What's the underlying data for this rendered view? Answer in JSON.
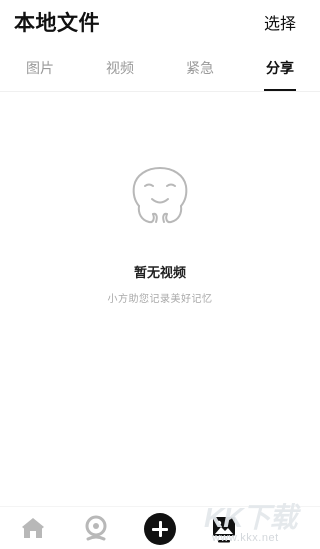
{
  "header": {
    "title": "本地文件",
    "select_label": "选择"
  },
  "tabs": [
    {
      "label": "图片",
      "active": false
    },
    {
      "label": "视频",
      "active": false
    },
    {
      "label": "紧急",
      "active": false
    },
    {
      "label": "分享",
      "active": true
    }
  ],
  "empty_state": {
    "icon": "smiling-face-icon",
    "title": "暂无视频",
    "subtitle": "小方助您记录美好记忆"
  },
  "bottom_nav": [
    {
      "icon": "home-icon"
    },
    {
      "icon": "discover-icon"
    },
    {
      "icon": "add-icon"
    },
    {
      "icon": "gallery-icon",
      "active": true
    }
  ],
  "watermark": {
    "logo": "KK下载",
    "url": "www.kkx.net"
  },
  "colors": {
    "text_primary": "#111111",
    "text_secondary": "#9a9a9a",
    "accent": "#111111",
    "icon_gray": "#b8b8b8"
  }
}
